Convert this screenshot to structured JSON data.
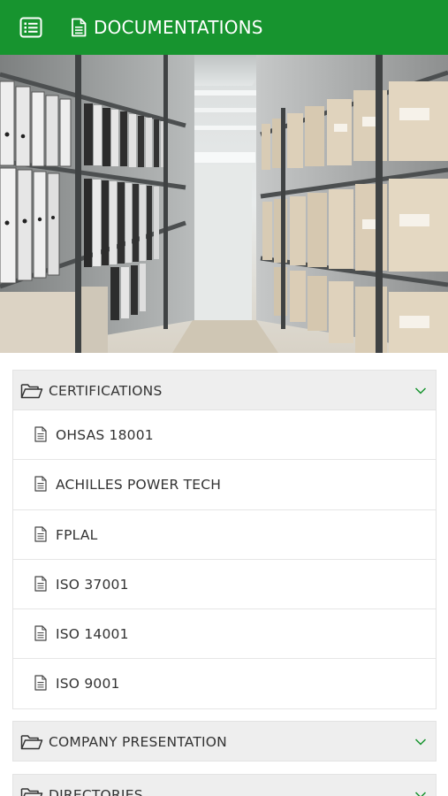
{
  "topbar": {
    "title": "DOCUMENTATIONS",
    "menu_icon": "list-icon",
    "title_icon": "document-icon",
    "color": "#17942f"
  },
  "hero": {
    "description_icon": "archive-shelves-photo"
  },
  "sections": [
    {
      "label": "CERTIFICATIONS",
      "expanded": true,
      "items": [
        {
          "label": "OHSAS 18001"
        },
        {
          "label": "ACHILLES POWER TECH"
        },
        {
          "label": "FPLAL"
        },
        {
          "label": "ISO 37001"
        },
        {
          "label": "ISO 14001"
        },
        {
          "label": "ISO 9001"
        }
      ]
    },
    {
      "label": "COMPANY PRESENTATION",
      "expanded": false,
      "items": []
    },
    {
      "label": "DIRECTORIES",
      "expanded": false,
      "items": []
    }
  ],
  "colors": {
    "accent": "#17942f",
    "header_bg": "#eeeeee",
    "text": "#333333"
  }
}
